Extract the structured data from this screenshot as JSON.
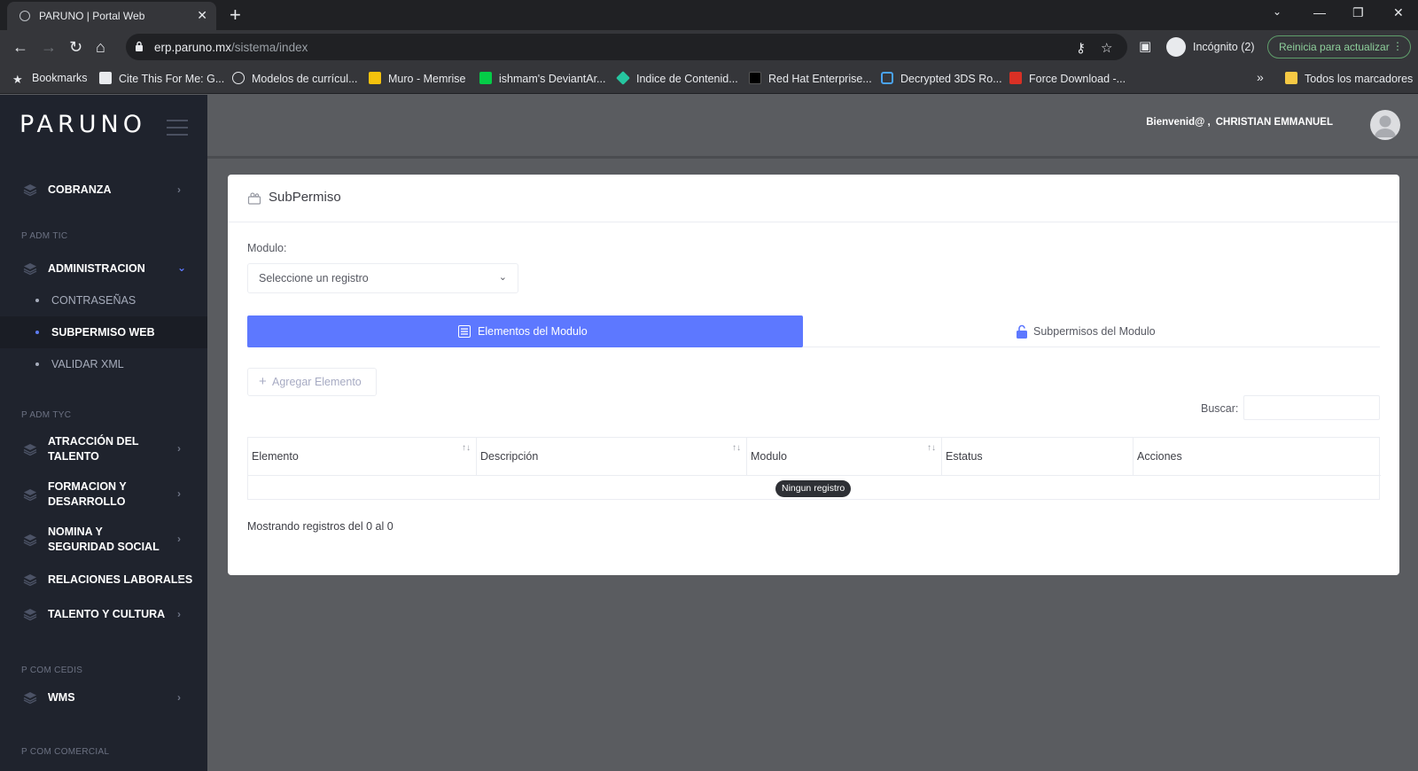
{
  "browser": {
    "tab_title": "PARUNO | Portal Web",
    "url_host": "erp.paruno.mx",
    "url_path": "/sistema/index",
    "incognito_label": "Incógnito (2)",
    "update_label": "Reinicia para actualizar",
    "bookmarks": [
      {
        "label": "Bookmarks",
        "icon": "star-icon"
      },
      {
        "label": "Cite This For Me: G...",
        "icon": "document-icon"
      },
      {
        "label": "Modelos de currícul...",
        "icon": "globe-icon"
      },
      {
        "label": "Muro - Memrise",
        "icon": "memrise-icon"
      },
      {
        "label": "ishmam's DeviantAr...",
        "icon": "deviantart-icon"
      },
      {
        "label": "Indice de Contenid...",
        "icon": "diamond-icon"
      },
      {
        "label": "Red Hat Enterprise...",
        "icon": "redhat-icon"
      },
      {
        "label": "Decrypted 3DS Ro...",
        "icon": "hexagon-icon"
      },
      {
        "label": "Force Download -...",
        "icon": "fd-icon"
      },
      {
        "label": "Todos los marcadores",
        "icon": "folder-icon"
      }
    ]
  },
  "sidebar": {
    "logo": "PARUNO",
    "items": [
      {
        "type": "item",
        "label": "COBRANZA"
      },
      {
        "type": "header",
        "label": "P ADM TIC"
      },
      {
        "type": "item",
        "label": "ADMINISTRACION"
      },
      {
        "type": "sub",
        "label": "CONTRASEÑAS"
      },
      {
        "type": "sub",
        "label": "SUBPERMISO WEB"
      },
      {
        "type": "sub",
        "label": "VALIDAR XML"
      },
      {
        "type": "header",
        "label": "P ADM TYC"
      },
      {
        "type": "item",
        "label": "ATRACCIÓN DEL TALENTO"
      },
      {
        "type": "item",
        "label": "FORMACION Y DESARROLLO"
      },
      {
        "type": "item",
        "label": "NOMINA Y SEGURIDAD SOCIAL"
      },
      {
        "type": "item",
        "label": "RELACIONES LABORALES"
      },
      {
        "type": "item",
        "label": "TALENTO Y CULTURA"
      },
      {
        "type": "header",
        "label": "P COM CEDIS"
      },
      {
        "type": "item",
        "label": "WMS"
      },
      {
        "type": "header",
        "label": "P COM COMERCIAL"
      }
    ]
  },
  "topbar": {
    "welcome_prefix": "Bienvenid@ ,",
    "user_name": "CHRISTIAN EMMANUEL"
  },
  "page": {
    "title": "SubPermiso",
    "modulo_label": "Modulo:",
    "modulo_value": "Seleccione un registro",
    "tabs": [
      "Elementos del Modulo",
      "Subpermisos del Modulo"
    ],
    "add_button": "Agregar Elemento",
    "search_label": "Buscar:",
    "search_value": "",
    "columns": [
      "Elemento",
      "Descripción",
      "Modulo",
      "Estatus",
      "Acciones"
    ],
    "empty_message": "Ningun registro",
    "info": "Mostrando registros del 0 al 0"
  },
  "colors": {
    "accent": "#5d78ff",
    "sidebar_bg": "#1f232d",
    "content_bg": "#5a5c60"
  }
}
